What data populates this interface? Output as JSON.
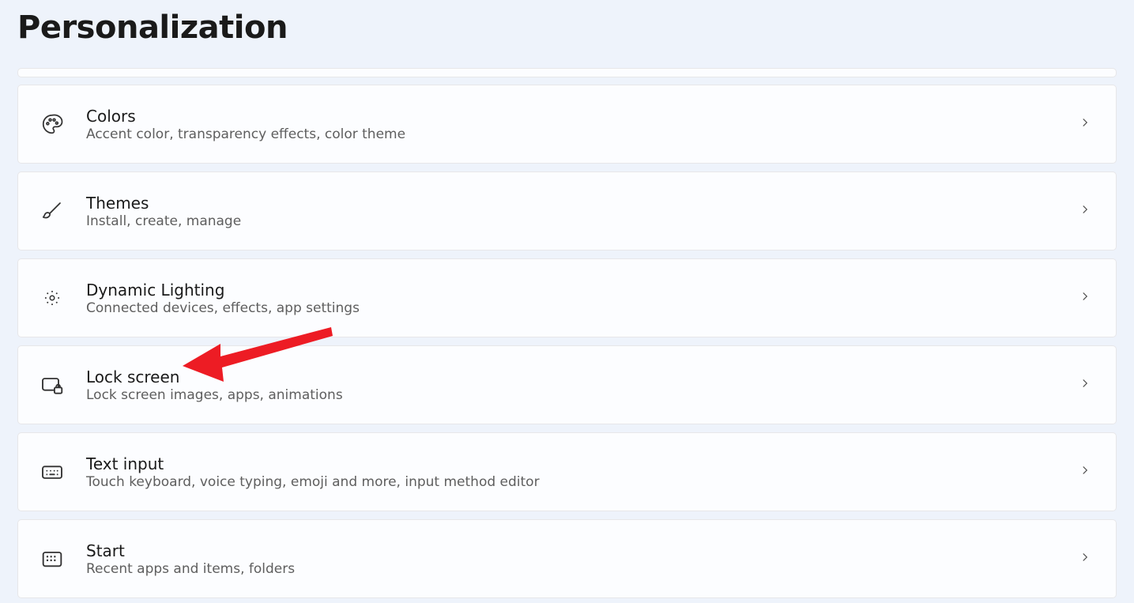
{
  "page": {
    "title": "Personalization"
  },
  "items": [
    {
      "id": "colors",
      "title": "Colors",
      "desc": "Accent color, transparency effects, color theme"
    },
    {
      "id": "themes",
      "title": "Themes",
      "desc": "Install, create, manage"
    },
    {
      "id": "dynamic-lighting",
      "title": "Dynamic Lighting",
      "desc": "Connected devices, effects, app settings"
    },
    {
      "id": "lock-screen",
      "title": "Lock screen",
      "desc": "Lock screen images, apps, animations"
    },
    {
      "id": "text-input",
      "title": "Text input",
      "desc": "Touch keyboard, voice typing, emoji and more, input method editor"
    },
    {
      "id": "start",
      "title": "Start",
      "desc": "Recent apps and items, folders"
    }
  ],
  "annotation": {
    "target": "lock-screen"
  }
}
